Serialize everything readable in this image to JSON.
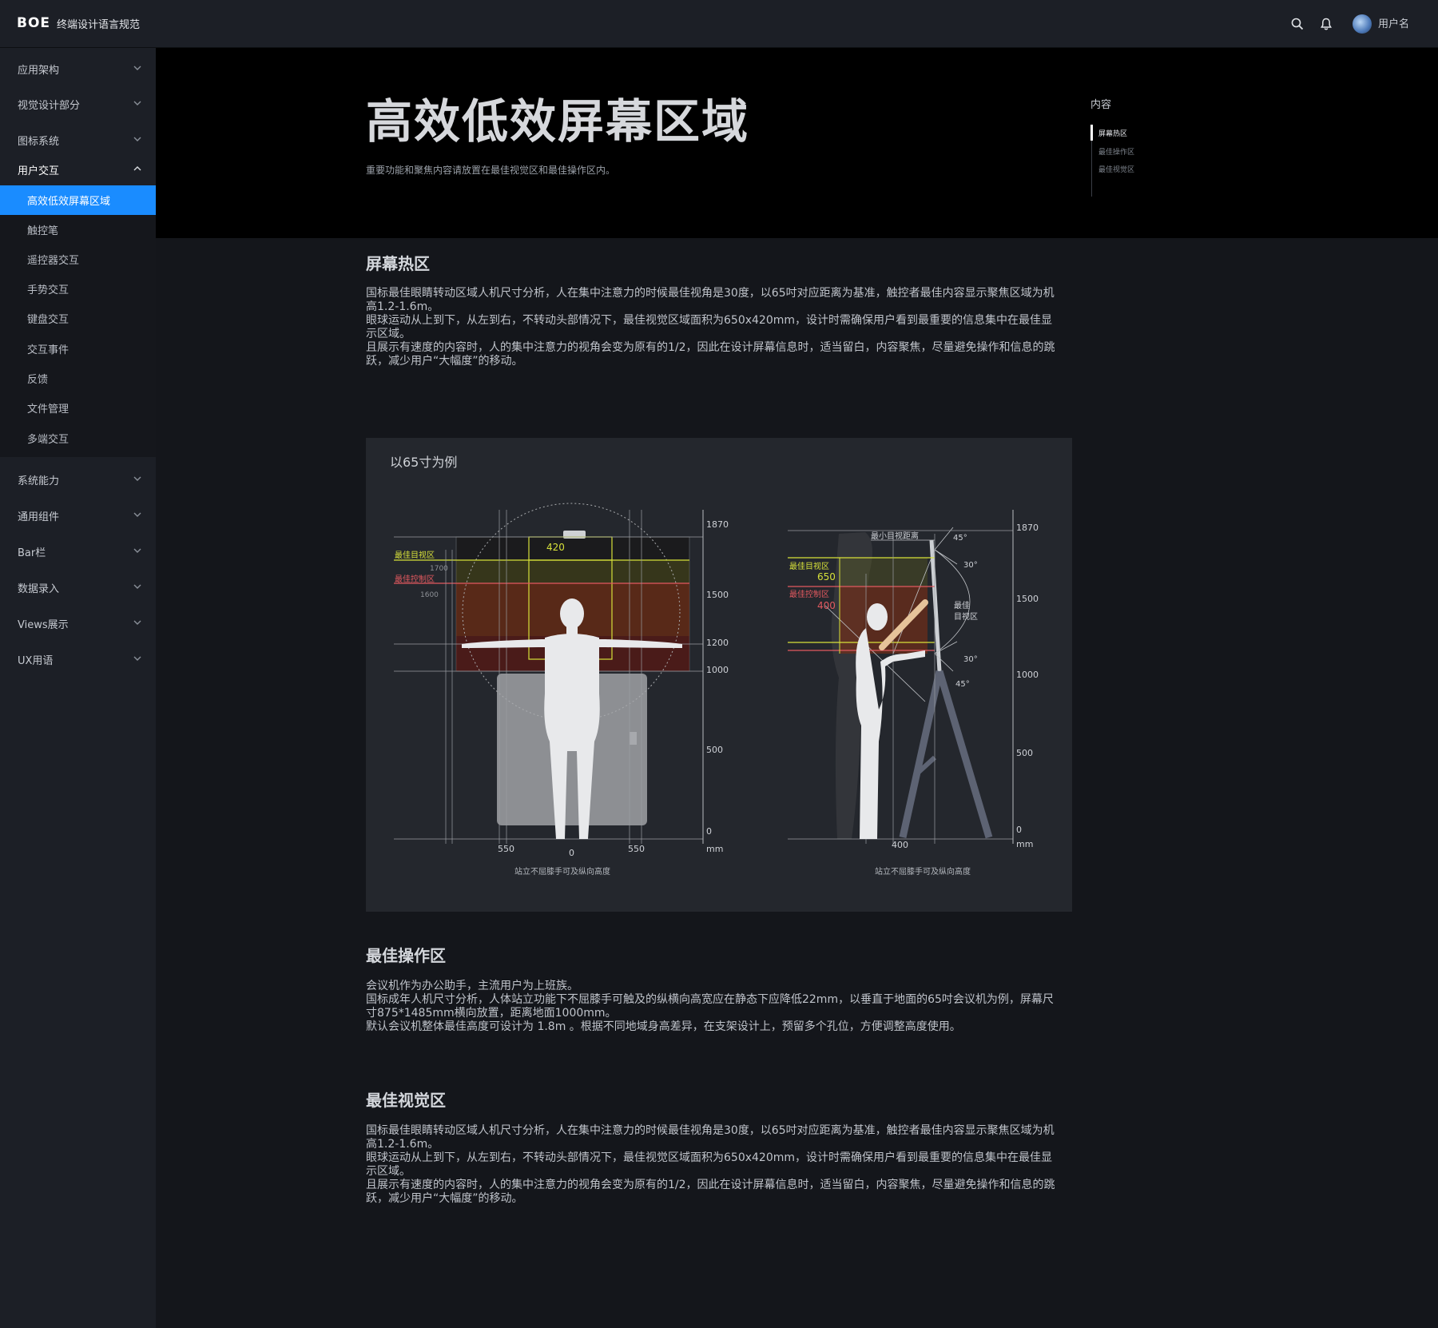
{
  "header": {
    "logo": "BOE",
    "app_title": "终端设计语言规范",
    "username": "用户名"
  },
  "sidebar": {
    "groups_top": [
      {
        "label": "应用架构"
      },
      {
        "label": "视觉设计部分"
      },
      {
        "label": "图标系统"
      },
      {
        "label": "用户交互"
      }
    ],
    "sub_items": [
      {
        "label": "高效低效屏幕区域"
      },
      {
        "label": "触控笔"
      },
      {
        "label": "遥控器交互"
      },
      {
        "label": "手势交互"
      },
      {
        "label": "键盘交互"
      },
      {
        "label": "交互事件"
      },
      {
        "label": "反馈"
      },
      {
        "label": "文件管理"
      },
      {
        "label": "多端交互"
      }
    ],
    "groups_bottom": [
      {
        "label": "系统能力"
      },
      {
        "label": "通用组件"
      },
      {
        "label": "Bar栏"
      },
      {
        "label": "数据录入"
      },
      {
        "label": "Views展示"
      },
      {
        "label": "UX用语"
      }
    ]
  },
  "hero": {
    "title": "高效低效屏幕区域",
    "subtitle": "重要功能和聚焦内容请放置在最佳视觉区和最佳操作区内。"
  },
  "toc": {
    "title": "内容",
    "items": [
      "屏幕热区",
      "最佳操作区",
      "最佳视觉区"
    ]
  },
  "sections": {
    "hotzone": {
      "title": "屏幕热区",
      "lines": [
        "国标最佳眼睛转动区域人机尺寸分析，人在集中注意力的时候最佳视角是30度，以65吋对应距离为基准，触控者最佳内容显示聚焦区域为机",
        "高1.2-1.6m。",
        "眼球运动从上到下，从左到右，不转动头部情况下，最佳视觉区域面积为650x420mm，设计时需确保用户看到最重要的信息集中在最佳显",
        "示区域。",
        "且展示有速度的内容时，人的集中注意力的视角会变为原有的1/2，因此在设计屏幕信息时，适当留白，内容聚焦，尽量避免操作和信息的跳",
        "跃，减少用户“大幅度”的移动。"
      ]
    },
    "operation": {
      "title": "最佳操作区",
      "lines": [
        "会议机作为办公助手，主流用户为上班族。",
        "国标成年人机尺寸分析，人体站立功能下不屈膝手可触及的纵横向高宽应在静态下应降低22mm，以垂直于地面的65吋会议机为例，屏幕尺",
        "寸875*1485mm横向放置，距离地面1000mm。",
        "默认会议机整体最佳高度可设计为 1.8m 。根据不同地域身高差异，在支架设计上，预留多个孔位，方便调整高度使用。"
      ]
    },
    "visual": {
      "title": "最佳视觉区",
      "lines": [
        "国标最佳眼睛转动区域人机尺寸分析，人在集中注意力的时候最佳视角是30度，以65吋对应距离为基准，触控者最佳内容显示聚焦区域为机",
        "高1.2-1.6m。",
        "眼球运动从上到下，从左到右，不转动头部情况下，最佳视觉区域面积为650x420mm，设计时需确保用户看到最重要的信息集中在最佳显",
        "示区域。",
        "且展示有速度的内容时，人的集中注意力的视角会变为原有的1/2，因此在设计屏幕信息时，适当留白，内容聚焦，尽量避免操作和信息的跳",
        "跃，减少用户“大幅度”的移动。"
      ]
    }
  },
  "figure": {
    "title": "以65寸为例",
    "front": {
      "width_label": "420",
      "label_visual": "最佳目视区",
      "label_visual_value": "1700",
      "label_control": "最佳控制区",
      "label_control_value": "1600",
      "axis_ticks": [
        "1870",
        "1500",
        "1200",
        "1000",
        "500",
        "0"
      ],
      "axis_unit": "mm",
      "bottom_ticks": [
        "550",
        "0",
        "550"
      ],
      "caption": "站立不屈膝手可及纵向高度"
    },
    "side": {
      "min_distance": "最小目视距离",
      "label_visual": "最佳目视区",
      "label_visual_value": "650",
      "label_control": "最佳控制区",
      "label_control_value": "400",
      "best_zone": [
        "最佳",
        "目视区"
      ],
      "angles": [
        "45°",
        "30°",
        "30°",
        "45°"
      ],
      "axis_ticks": [
        "1870",
        "1500",
        "1000",
        "500",
        "0"
      ],
      "axis_unit": "mm",
      "bottom_tick": "400",
      "caption": "站立不屈膝手可及纵向高度"
    },
    "colors": {
      "visual": "#d7e13a",
      "control": "#e2595f"
    }
  }
}
